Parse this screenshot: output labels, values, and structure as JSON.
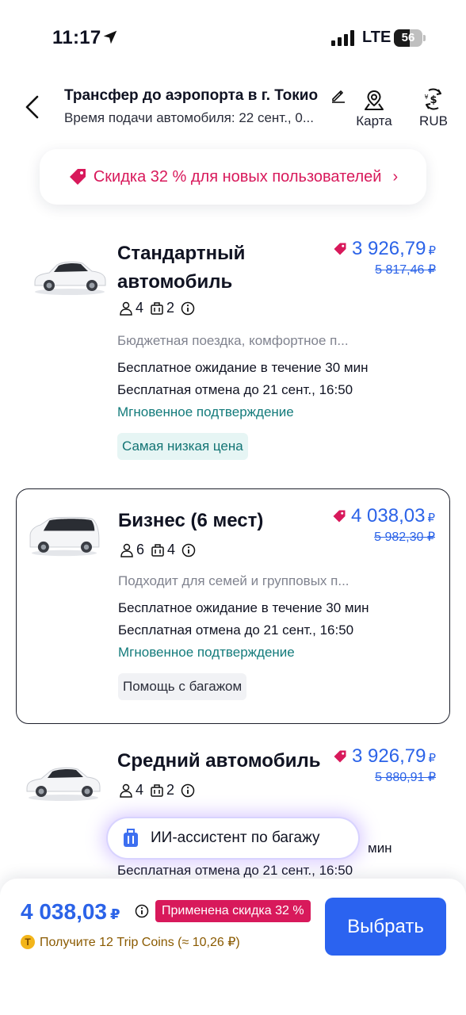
{
  "status_bar": {
    "time": "11:17",
    "network": "LTE",
    "battery_level": "56",
    "battery_fraction": 0.56
  },
  "header": {
    "title": "Трансфер до аэропорта в г. Токио",
    "subtitle": "Время подачи автомобиля: 22 сент., 0...",
    "map_label": "Карта",
    "currency_label": "RUB"
  },
  "promo": {
    "text": "Скидка 32 % для новых пользователей"
  },
  "cars": [
    {
      "name_line1": "Стандартный",
      "name_line2": "автомобиль",
      "price": "3 926,79",
      "currency": "₽",
      "old_price": "5 817,46 ₽",
      "passengers": "4",
      "luggage": "2",
      "description": "Бюджетная поездка, комфортное п...",
      "feature1": "Бесплатное ожидание в течение 30 мин",
      "feature2": "Бесплатная отмена до 21 сент., 16:50",
      "feature3": "Мгновенное подтверждение",
      "badge": "Самая низкая цена"
    },
    {
      "name": "Бизнес (6 мест)",
      "price": "4 038,03",
      "currency": "₽",
      "old_price": "5 982,30 ₽",
      "passengers": "6",
      "luggage": "4",
      "description": "Подходит для семей и групповых п...",
      "feature1": "Бесплатное ожидание в течение 30 мин",
      "feature2": "Бесплатная отмена до 21 сент., 16:50",
      "feature3": "Мгновенное подтверждение",
      "badge": "Помощь с багажом"
    },
    {
      "name": "Средний автомобиль",
      "price": "3 926,79",
      "currency": "₽",
      "old_price": "5 880,91 ₽",
      "passengers": "4",
      "luggage": "2",
      "feature1_tail": "мин",
      "feature2": "Бесплатная отмена до 21 сент., 16:50"
    }
  ],
  "ai_assistant": {
    "label": "ИИ-ассистент по багажу"
  },
  "bottom_bar": {
    "total_price": "4 038,03",
    "currency": "₽",
    "discount_badge": "Применена скидка 32 %",
    "coins_text": "Получите 12 Trip Coins (≈ 10,26 ₽)",
    "coin_symbol": "T",
    "select_label": "Выбрать"
  },
  "colors": {
    "accent_blue": "#2b63e8",
    "promo_pink": "#d8195b",
    "teal": "#137b7b"
  }
}
